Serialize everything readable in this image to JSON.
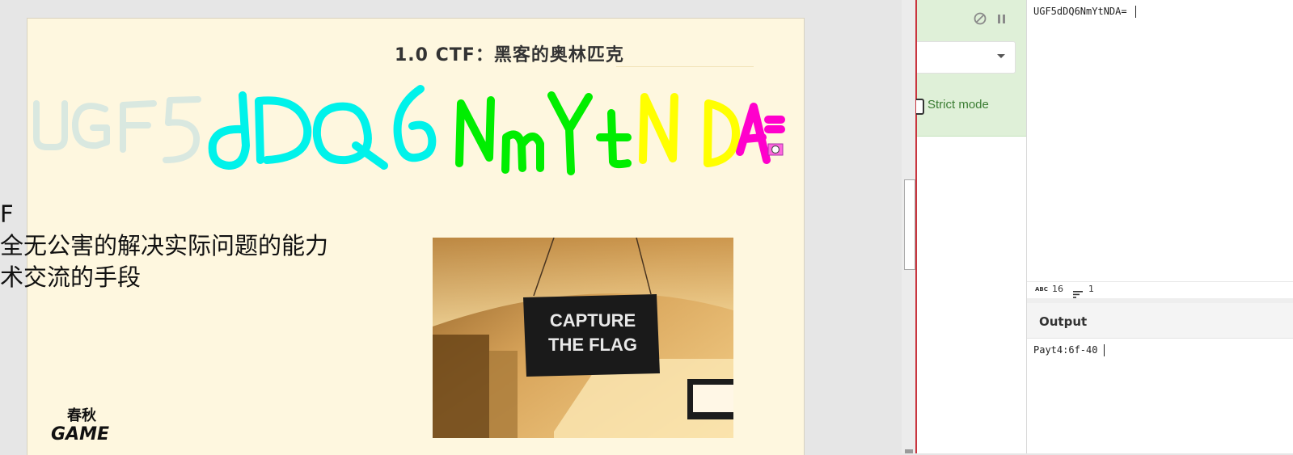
{
  "slide": {
    "title": "1.0  CTF：黑客的奥林匹克",
    "body_lines": [
      "F",
      "全无公害的解决实际问题的能力",
      "术交流的手段"
    ],
    "photo_sign": [
      "CAPTURE",
      "THE FLAG"
    ],
    "logo_text": [
      "春秋",
      "GAME"
    ],
    "graffiti": {
      "text": "UGF5dDQ6NmYtNDA=",
      "segments": [
        {
          "chars": "UGF5",
          "color": "#d9e8e0"
        },
        {
          "chars": "dDQ6",
          "color": "#00f2ea"
        },
        {
          "chars": "NmYt",
          "color": "#00ee00"
        },
        {
          "chars": "ND",
          "color": "#ffff00"
        },
        {
          "chars": "A=",
          "color": "#ff00cc"
        }
      ]
    }
  },
  "recipe": {
    "strict_mode_label": "Strict mode",
    "strict_mode_checked": false
  },
  "input": {
    "value": "UGF5dDQ6NmYtNDA=",
    "length_label": "16",
    "lines_label": "1"
  },
  "output": {
    "title": "Output",
    "value": "Payt4:6f-40"
  }
}
